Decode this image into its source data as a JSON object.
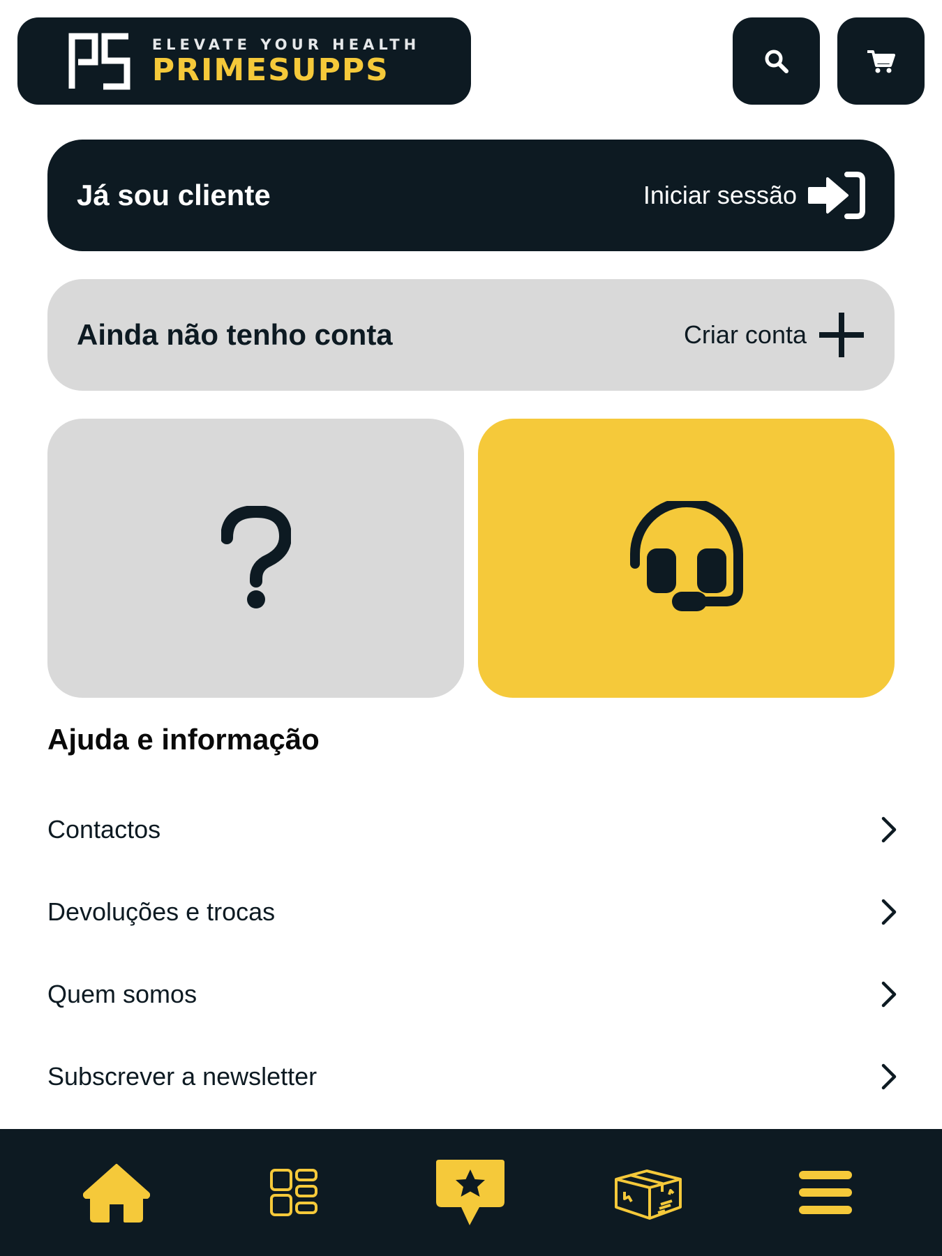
{
  "header": {
    "logo": {
      "letters": "PS",
      "tagline": "ELEVATE YOUR HEALTH",
      "name": "PRIMESUPPS"
    },
    "buttons": [
      {
        "icon": "search-icon"
      },
      {
        "icon": "cart-icon"
      }
    ]
  },
  "account": {
    "login": {
      "title": "Já sou cliente",
      "action": "Iniciar sessão",
      "icon": "sign-in-icon"
    },
    "register": {
      "title": "Ainda não tenho conta",
      "action": "Criar conta",
      "icon": "plus-icon"
    }
  },
  "tiles": [
    {
      "icon": "question-mark-icon",
      "color": "#d9d9d9"
    },
    {
      "icon": "headset-icon",
      "color": "#f5c93a"
    }
  ],
  "help": {
    "title": "Ajuda e informação",
    "items": [
      {
        "label": "Contactos"
      },
      {
        "label": "Devoluções e trocas"
      },
      {
        "label": "Quem somos"
      },
      {
        "label": "Subscrever a newsletter"
      }
    ]
  },
  "bottom_nav": {
    "items": [
      {
        "icon": "home-icon"
      },
      {
        "icon": "categories-icon"
      },
      {
        "icon": "star-badge-icon"
      },
      {
        "icon": "package-icon"
      },
      {
        "icon": "menu-icon"
      }
    ]
  },
  "colors": {
    "dark": "#0d1a22",
    "accent": "#f5c93a",
    "light_gray": "#d9d9d9",
    "white": "#ffffff"
  }
}
